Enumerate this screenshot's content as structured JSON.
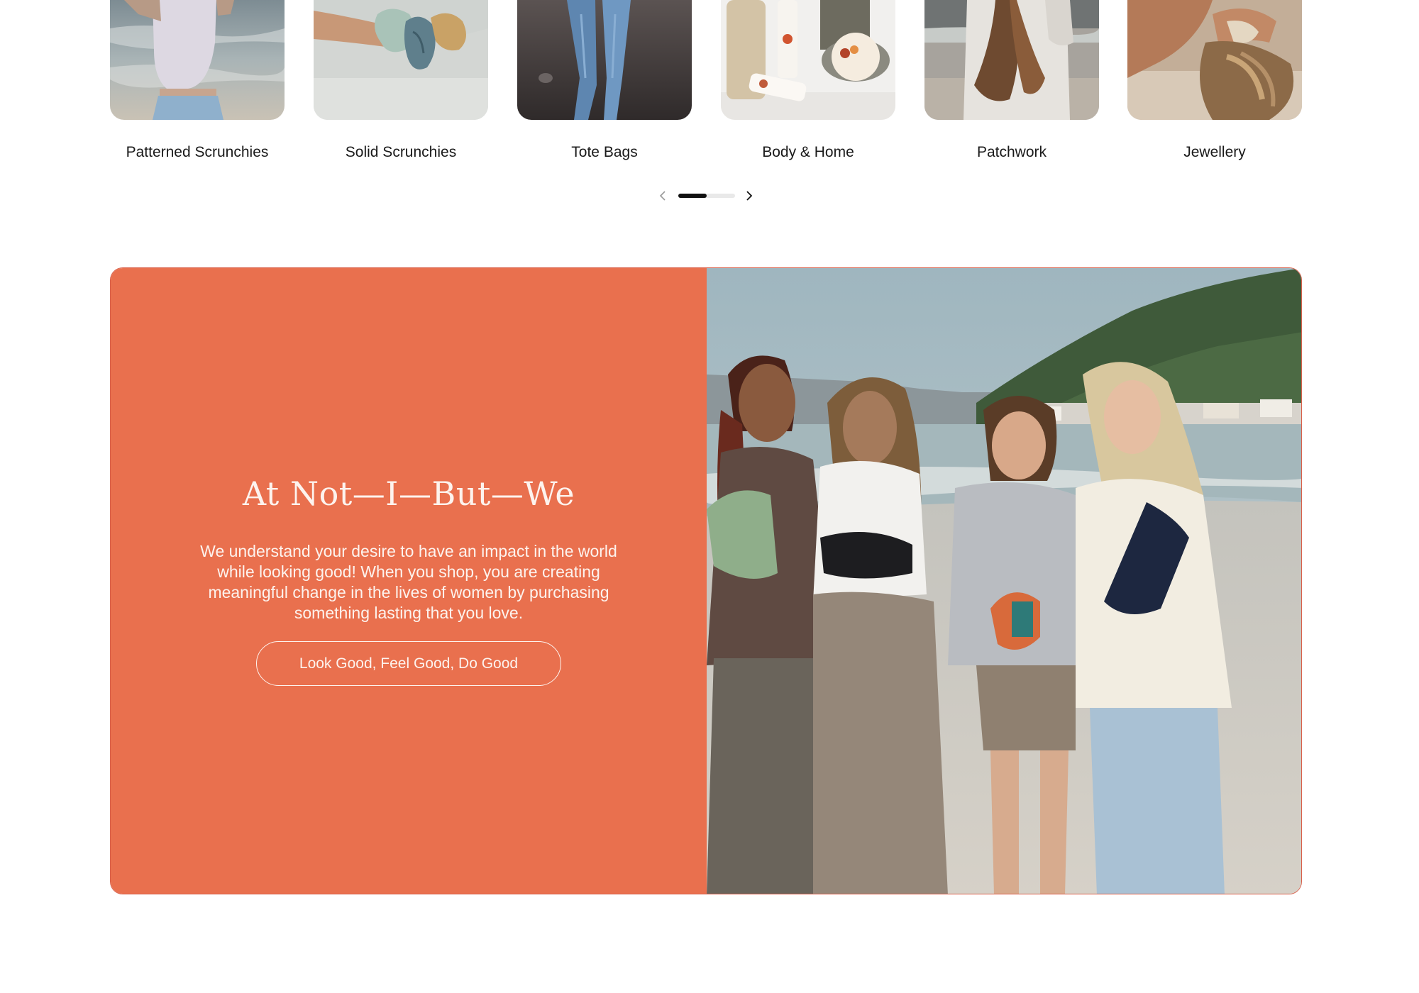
{
  "categories": {
    "items": [
      {
        "label": "Patterned Scrunchies",
        "image": "woman-at-beach-photo"
      },
      {
        "label": "Solid Scrunchies",
        "image": "scrunchies-on-wrist-photo"
      },
      {
        "label": "Tote Bags",
        "image": "person-in-jeans-photo"
      },
      {
        "label": "Body & Home",
        "image": "skincare-products-photo"
      },
      {
        "label": "Patchwork",
        "image": "woman-in-hoodie-photo"
      },
      {
        "label": "Jewellery",
        "image": "hair-tie-bracelet-photo"
      }
    ],
    "pager": {
      "prev_icon": "chevron-left-icon",
      "next_icon": "chevron-right-icon",
      "progress": 0.5
    }
  },
  "banner": {
    "heading": "At Not—I—But—We",
    "body": "We understand your desire to have an impact in the world while looking good! When you shop, you are creating meaningful change in the lives of women by purchasing something lasting that you love.",
    "cta_label": "Look Good, Feel Good, Do Good",
    "image": "four-women-on-beach-photo",
    "accent_color": "#e9704e"
  }
}
